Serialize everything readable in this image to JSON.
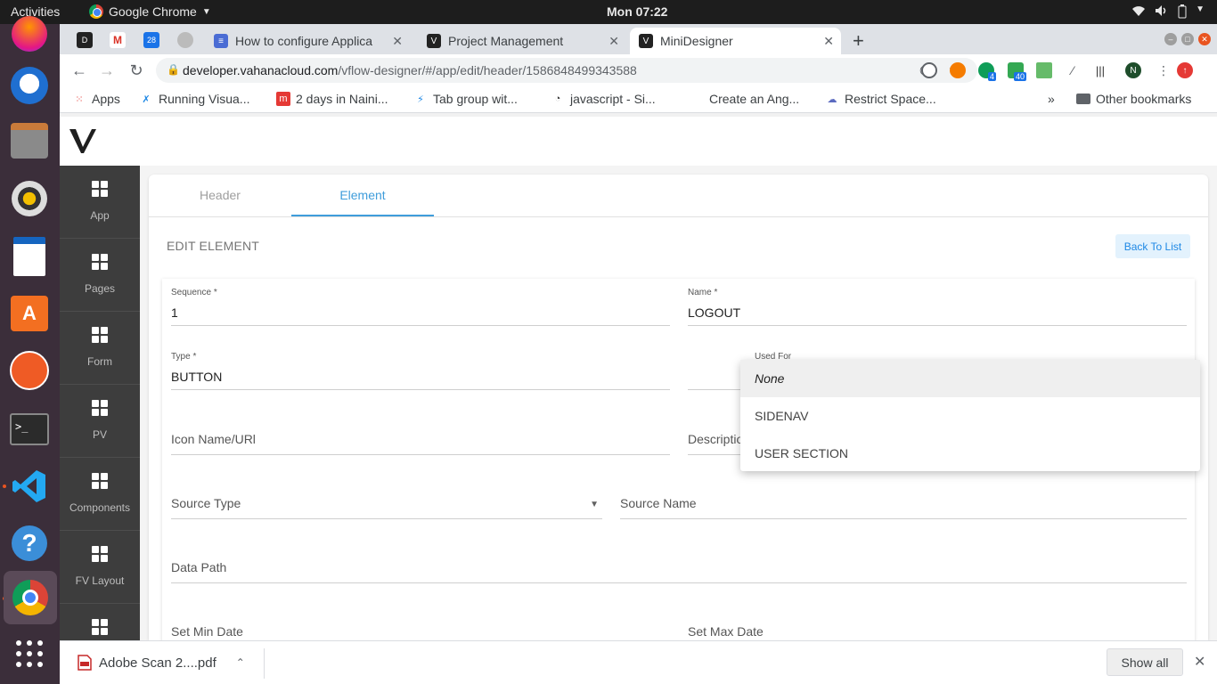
{
  "topbar": {
    "activities": "Activities",
    "app_name": "Google Chrome",
    "clock": "Mon 07:22"
  },
  "tabs": [
    {
      "title": "How to configure Applica"
    },
    {
      "title": "Project Management"
    },
    {
      "title": "MiniDesigner",
      "active": true
    }
  ],
  "pinned_tabs": {
    "calendar_badge": "28"
  },
  "omnibox": {
    "domain": "developer.vahanacloud.com",
    "path": "/vflow-designer/#/app/edit/header/1586848499343588"
  },
  "extensions": {
    "badge_a": "4",
    "badge_b": "40",
    "profile_initial": "N"
  },
  "bookmarks": {
    "items": [
      {
        "label": "Apps"
      },
      {
        "label": "Running Visua..."
      },
      {
        "label": "2 days in Naini..."
      },
      {
        "label": "Tab group wit..."
      },
      {
        "label": "javascript - Si..."
      },
      {
        "label": "Create an Ang..."
      },
      {
        "label": "Restrict Space..."
      }
    ],
    "overflow": "»",
    "other": "Other bookmarks"
  },
  "sidenav": {
    "items": [
      {
        "label": "App"
      },
      {
        "label": "Pages"
      },
      {
        "label": "Form"
      },
      {
        "label": "PV"
      },
      {
        "label": "Components"
      },
      {
        "label": "FV Layout"
      },
      {
        "label": ""
      }
    ]
  },
  "content": {
    "tabs": {
      "header": "Header",
      "element": "Element"
    },
    "title": "EDIT ELEMENT",
    "back_button": "Back To List"
  },
  "form": {
    "sequence": {
      "label": "Sequence *",
      "value": "1"
    },
    "name": {
      "label": "Name *",
      "value": "LOGOUT"
    },
    "type": {
      "label": "Type *",
      "value": "BUTTON"
    },
    "used_for": {
      "label": "Used For"
    },
    "icon": {
      "placeholder": "Icon Name/URl"
    },
    "description": {
      "placeholder": "Description"
    },
    "source_type": {
      "placeholder": "Source Type"
    },
    "source_name": {
      "placeholder": "Source Name"
    },
    "data_path": {
      "placeholder": "Data Path"
    },
    "min_date": {
      "placeholder": "Set Min Date"
    },
    "max_date": {
      "placeholder": "Set Max Date"
    }
  },
  "dropdown": {
    "options": [
      {
        "label": "None",
        "selected": true
      },
      {
        "label": "SIDENAV"
      },
      {
        "label": "USER SECTION"
      }
    ]
  },
  "downloads": {
    "file": "Adobe Scan 2....pdf",
    "show_all": "Show all"
  },
  "colors": {
    "accent": "#3f9ddb",
    "sidenav": "#3d3d3d",
    "dock": "#3b2e3a"
  }
}
